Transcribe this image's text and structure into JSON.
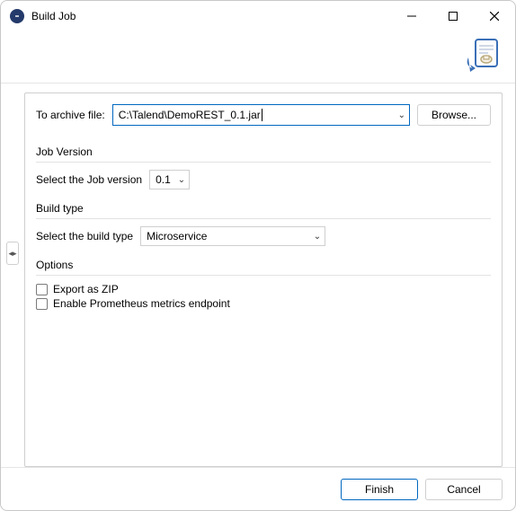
{
  "window": {
    "title": "Build Job"
  },
  "archive": {
    "label": "To archive file:",
    "value": "C:\\Talend\\DemoREST_0.1.jar",
    "browse": "Browse..."
  },
  "jobVersion": {
    "title": "Job Version",
    "label": "Select the Job version",
    "value": "0.1"
  },
  "buildType": {
    "title": "Build type",
    "label": "Select the build type",
    "value": "Microservice"
  },
  "options": {
    "title": "Options",
    "exportZip": "Export as ZIP",
    "prometheus": "Enable Prometheus metrics endpoint"
  },
  "footer": {
    "finish": "Finish",
    "cancel": "Cancel"
  }
}
